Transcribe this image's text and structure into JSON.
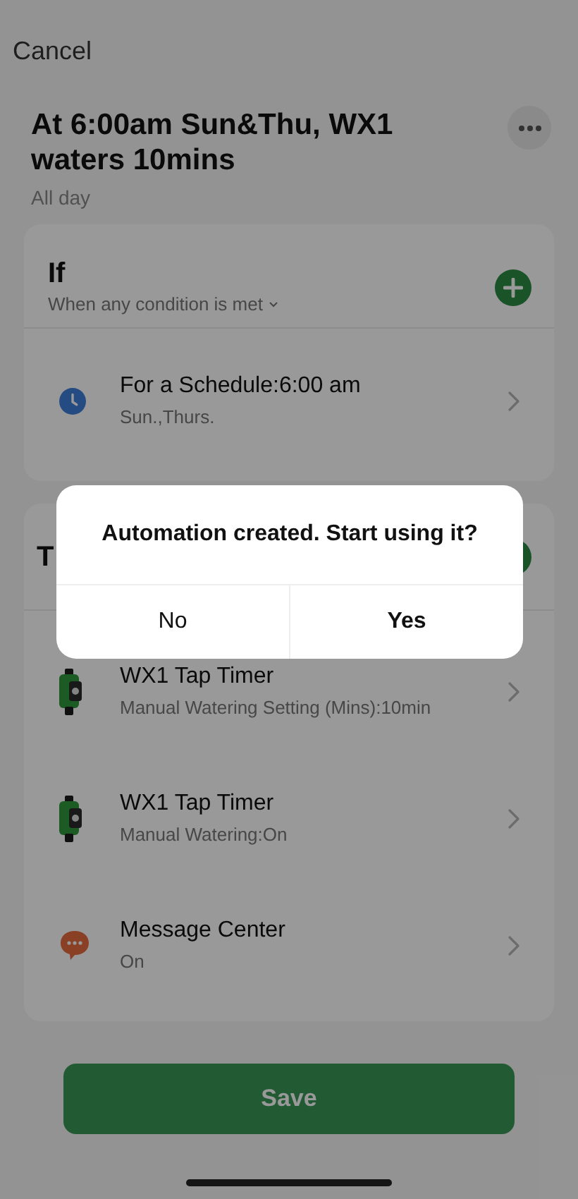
{
  "header": {
    "cancel": "Cancel"
  },
  "automation": {
    "title": "At 6:00am Sun&Thu, WX1 waters 10mins",
    "subtitle": "All day"
  },
  "if_section": {
    "title": "If",
    "condition_mode": "When any condition is met",
    "conditions": [
      {
        "kind": "schedule",
        "title": "For a Schedule:6:00 am",
        "detail": "Sun.,Thurs."
      }
    ]
  },
  "then_section": {
    "title": "T",
    "actions": [
      {
        "kind": "tap-timer",
        "title": "WX1 Tap Timer",
        "detail": "Manual Watering Setting (Mins):10min"
      },
      {
        "kind": "tap-timer",
        "title": "WX1 Tap Timer",
        "detail": "Manual Watering:On"
      },
      {
        "kind": "message",
        "title": "Message Center",
        "detail": "On"
      }
    ]
  },
  "dialog": {
    "message": "Automation created. Start using it?",
    "buttons": [
      {
        "label": "No",
        "primary": false
      },
      {
        "label": "Yes",
        "primary": true
      }
    ]
  },
  "save_button": "Save"
}
